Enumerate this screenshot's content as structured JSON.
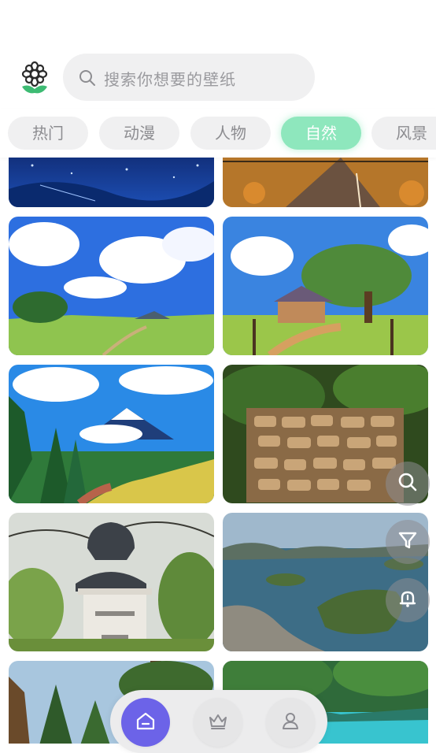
{
  "header": {
    "logo_icon": "flower-icon",
    "search": {
      "placeholder": "搜索你想要的壁纸",
      "icon": "search-icon"
    }
  },
  "tabs": [
    {
      "label": "热门",
      "active": false
    },
    {
      "label": "动漫",
      "active": false
    },
    {
      "label": "人物",
      "active": false
    },
    {
      "label": "自然",
      "active": true
    },
    {
      "label": "风景",
      "active": false
    }
  ],
  "colors": {
    "accent_green": "#8ee7bd",
    "nav_active": "#6c63e8",
    "tab_bg": "#f0f0f1"
  },
  "wallpapers": [
    {
      "name": "night-sky-wallpaper"
    },
    {
      "name": "sunset-road-wallpaper"
    },
    {
      "name": "anime-meadow-clouds-wallpaper"
    },
    {
      "name": "anime-farmhouse-tree-wallpaper"
    },
    {
      "name": "anime-mount-fuji-wallpaper"
    },
    {
      "name": "stacked-firewood-wallpaper"
    },
    {
      "name": "bust-statue-park-wallpaper"
    },
    {
      "name": "lake-islands-aerial-wallpaper"
    },
    {
      "name": "forest-trees-wallpaper"
    },
    {
      "name": "tropical-lagoon-wallpaper"
    }
  ],
  "floating_actions": [
    "search-icon",
    "filter-icon",
    "bell-icon"
  ],
  "bottom_nav": [
    {
      "icon": "home-icon",
      "active": true
    },
    {
      "icon": "crown-icon",
      "active": false
    },
    {
      "icon": "user-icon",
      "active": false
    }
  ]
}
